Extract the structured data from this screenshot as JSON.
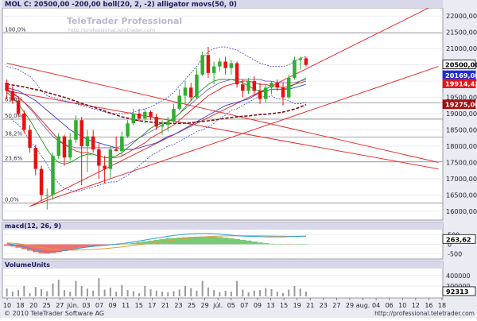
{
  "header": {
    "title": "MOL C: 20500,00 -200,00 boll(20, 2, -2) alligator movs(50, 0)",
    "watermark_brand": "TeleTrader Professional",
    "watermark_url": "http://professional.teletrader.com"
  },
  "footer": {
    "copyright": "© 2010 TeleTrader Software AG",
    "url": "http://professional.teletrader.com"
  },
  "colors": {
    "up": "#2fae2f",
    "down": "#e81010",
    "trendline": "#e63232",
    "boll_band": "#2b2bd0",
    "boll_mid": "#6a3ab0",
    "jaw": "#3b3bd8",
    "teeth": "#e21a1a",
    "lips": "#1a9a1a",
    "sma": "#7a1111",
    "macd_fill": "#ee7070",
    "macd_fill_pos": "#79c979",
    "macd_line": "#2aa0d8",
    "signal_line": "#e89a30",
    "volume": "#999999",
    "panel_bg": "#ffffff",
    "page_bg": "#ebebf3",
    "header_bg": "#d8d8ea"
  },
  "chart_data": [
    {
      "type": "candlestick",
      "title": "MOL C: 20500,00 -200,00 boll(20, 2, -2) alligator movs(50, 0)",
      "ylim": [
        15800,
        22200
      ],
      "yticks": [
        16000,
        16500,
        17000,
        17500,
        18000,
        18500,
        19000,
        19500,
        20000,
        20500,
        21000,
        21500,
        22000
      ],
      "ytick_labels": [
        "16000,00",
        "16500,00",
        "17000,00",
        "17500,00",
        "18000,00",
        "18500,00",
        "19000,00",
        "19500,00",
        "20000,00",
        "20500,00",
        "21000,00",
        "21500,00",
        "22000,00"
      ],
      "xtick_labels": [
        "10",
        "18",
        "20",
        "25",
        "27",
        "jún.",
        "03",
        "07",
        "09",
        "11",
        "15",
        "17",
        "21",
        "23",
        "25",
        "29",
        "júl.",
        "05",
        "07",
        "09",
        "13",
        "15",
        "19",
        "21",
        "23",
        "27",
        "29",
        "aug.",
        "04",
        "06",
        "10",
        "12",
        "16",
        "18"
      ],
      "candles": [
        {
          "o": 19950,
          "h": 20050,
          "l": 19450,
          "c": 19700
        },
        {
          "o": 19700,
          "h": 19850,
          "l": 19300,
          "c": 19400
        },
        {
          "o": 19400,
          "h": 19550,
          "l": 18900,
          "c": 19000
        },
        {
          "o": 19000,
          "h": 19100,
          "l": 18400,
          "c": 18500
        },
        {
          "o": 18500,
          "h": 18650,
          "l": 17800,
          "c": 17950
        },
        {
          "o": 17950,
          "h": 18050,
          "l": 17100,
          "c": 17300
        },
        {
          "o": 17300,
          "h": 17400,
          "l": 16300,
          "c": 16500
        },
        {
          "o": 16500,
          "h": 16700,
          "l": 16050,
          "c": 16500
        },
        {
          "o": 16500,
          "h": 17800,
          "l": 16350,
          "c": 17700
        },
        {
          "o": 17700,
          "h": 18400,
          "l": 17600,
          "c": 18300
        },
        {
          "o": 18300,
          "h": 18350,
          "l": 17400,
          "c": 17650
        },
        {
          "o": 17650,
          "h": 18400,
          "l": 17550,
          "c": 18200
        },
        {
          "o": 18200,
          "h": 18950,
          "l": 18100,
          "c": 18800
        },
        {
          "o": 18800,
          "h": 18900,
          "l": 16800,
          "c": 18000
        },
        {
          "o": 18000,
          "h": 18500,
          "l": 17200,
          "c": 18300
        },
        {
          "o": 18300,
          "h": 18500,
          "l": 17800,
          "c": 17900
        },
        {
          "o": 17900,
          "h": 18100,
          "l": 17000,
          "c": 17400
        },
        {
          "o": 17400,
          "h": 17700,
          "l": 16850,
          "c": 17300
        },
        {
          "o": 17300,
          "h": 18000,
          "l": 17000,
          "c": 17900
        },
        {
          "o": 17900,
          "h": 18300,
          "l": 17850,
          "c": 17850
        },
        {
          "o": 17850,
          "h": 18450,
          "l": 17700,
          "c": 18300
        },
        {
          "o": 18300,
          "h": 18800,
          "l": 18250,
          "c": 18700
        },
        {
          "o": 18700,
          "h": 19150,
          "l": 18650,
          "c": 19000
        },
        {
          "o": 19000,
          "h": 19150,
          "l": 18750,
          "c": 18850
        },
        {
          "o": 18850,
          "h": 19150,
          "l": 18700,
          "c": 19050
        },
        {
          "o": 19050,
          "h": 19100,
          "l": 18800,
          "c": 18900
        },
        {
          "o": 18900,
          "h": 19000,
          "l": 18500,
          "c": 18600
        },
        {
          "o": 18600,
          "h": 18800,
          "l": 18350,
          "c": 18650
        },
        {
          "o": 18650,
          "h": 18900,
          "l": 18450,
          "c": 18750
        },
        {
          "o": 18750,
          "h": 19300,
          "l": 18700,
          "c": 19150
        },
        {
          "o": 19150,
          "h": 19750,
          "l": 19100,
          "c": 19550
        },
        {
          "o": 19550,
          "h": 20000,
          "l": 19300,
          "c": 19800
        },
        {
          "o": 19800,
          "h": 19950,
          "l": 19400,
          "c": 19500
        },
        {
          "o": 19500,
          "h": 20400,
          "l": 19450,
          "c": 20200
        },
        {
          "o": 20200,
          "h": 20900,
          "l": 20150,
          "c": 20800
        },
        {
          "o": 20800,
          "h": 21050,
          "l": 20100,
          "c": 20250
        },
        {
          "o": 20250,
          "h": 20600,
          "l": 19900,
          "c": 20450
        },
        {
          "o": 20450,
          "h": 20700,
          "l": 20300,
          "c": 20600
        },
        {
          "o": 20600,
          "h": 20750,
          "l": 20200,
          "c": 20400
        },
        {
          "o": 20400,
          "h": 20650,
          "l": 20200,
          "c": 20550
        },
        {
          "o": 20550,
          "h": 20600,
          "l": 19800,
          "c": 19900
        },
        {
          "o": 19900,
          "h": 20050,
          "l": 19500,
          "c": 19700
        },
        {
          "o": 19700,
          "h": 20100,
          "l": 19600,
          "c": 20000
        },
        {
          "o": 20000,
          "h": 20150,
          "l": 19550,
          "c": 19700
        },
        {
          "o": 19700,
          "h": 19950,
          "l": 19300,
          "c": 19450
        },
        {
          "o": 19450,
          "h": 19900,
          "l": 19350,
          "c": 19800
        },
        {
          "o": 19800,
          "h": 20000,
          "l": 19600,
          "c": 19950
        },
        {
          "o": 19950,
          "h": 20050,
          "l": 19700,
          "c": 19800
        },
        {
          "o": 19800,
          "h": 19950,
          "l": 19250,
          "c": 19500
        },
        {
          "o": 19500,
          "h": 20200,
          "l": 19450,
          "c": 20100
        },
        {
          "o": 20100,
          "h": 20750,
          "l": 20050,
          "c": 20650
        },
        {
          "o": 20650,
          "h": 20750,
          "l": 20350,
          "c": 20700
        },
        {
          "o": 20700,
          "h": 20750,
          "l": 20450,
          "c": 20500
        }
      ],
      "bollinger": {
        "upper": [
          20450,
          20400,
          20350,
          20250,
          20150,
          19950,
          19700,
          19550,
          19500,
          19450,
          19400,
          19350,
          19300,
          19250,
          19200,
          19150,
          19100,
          19050,
          19000,
          19000,
          19000,
          19000,
          19050,
          19100,
          19150,
          19200,
          19300,
          19400,
          19500,
          19650,
          19850,
          20050,
          20250,
          20450,
          20700,
          20900,
          21000,
          21050,
          21050,
          21000,
          20950,
          20850,
          20750,
          20650,
          20550,
          20500,
          20450,
          20450,
          20450,
          20500,
          20600,
          20700,
          20750
        ],
        "middle": [
          19700,
          19600,
          19500,
          19350,
          19150,
          18950,
          18700,
          18500,
          18300,
          18150,
          18050,
          18000,
          17950,
          17950,
          17950,
          17950,
          17950,
          17950,
          17950,
          17950,
          18000,
          18050,
          18150,
          18250,
          18350,
          18450,
          18550,
          18650,
          18750,
          18850,
          19000,
          19150,
          19300,
          19450,
          19600,
          19750,
          19850,
          19950,
          20000,
          20050,
          20050,
          20050,
          20050,
          20050,
          20050,
          20000,
          20000,
          19950,
          19950,
          19950,
          19950,
          20000,
          20050
        ],
        "lower": [
          18950,
          18800,
          18650,
          18450,
          18150,
          17950,
          17700,
          17450,
          17100,
          16850,
          16700,
          16650,
          16600,
          16650,
          16700,
          16750,
          16800,
          16850,
          16900,
          16900,
          17000,
          17100,
          17250,
          17400,
          17550,
          17700,
          17800,
          17900,
          18000,
          18050,
          18150,
          18250,
          18350,
          18450,
          18500,
          18600,
          18700,
          18850,
          18950,
          19100,
          19150,
          19250,
          19350,
          19450,
          19550,
          19500,
          19550,
          19450,
          19450,
          19400,
          19300,
          19300,
          19350
        ]
      },
      "alligator": {
        "jaw": [
          19800,
          19750,
          19700,
          19600,
          19500,
          19400,
          19250,
          19100,
          18950,
          18800,
          18650,
          18500,
          18400,
          18300,
          18200,
          18150,
          18100,
          18050,
          18000,
          17950,
          17900,
          17900,
          17900,
          17950,
          18000,
          18050,
          18100,
          18200,
          18300,
          18350,
          18450,
          18550,
          18650,
          18750,
          18850,
          18950,
          19050,
          19150,
          19250,
          19300,
          19350,
          19400,
          19450,
          19550,
          19650,
          19700,
          19750,
          19750,
          19750,
          19750,
          19800,
          19850,
          19900
        ],
        "teeth": [
          19750,
          19650,
          19500,
          19350,
          19200,
          19000,
          18800,
          18600,
          18400,
          18200,
          18050,
          17950,
          17850,
          17800,
          17800,
          17750,
          17700,
          17650,
          17650,
          17650,
          17700,
          17800,
          17900,
          18000,
          18100,
          18250,
          18350,
          18450,
          18550,
          18650,
          18800,
          18950,
          19100,
          19250,
          19400,
          19550,
          19650,
          19750,
          19850,
          19900,
          19950,
          20000,
          20000,
          19950,
          19900,
          19900,
          19850,
          19850,
          19800,
          19850,
          19900,
          19950,
          20000
        ],
        "lips": [
          19650,
          19500,
          19300,
          19050,
          18800,
          18500,
          18200,
          17900,
          17650,
          17500,
          17450,
          17500,
          17600,
          17700,
          17750,
          17750,
          17700,
          17650,
          17650,
          17700,
          17800,
          17950,
          18100,
          18250,
          18400,
          18550,
          18650,
          18700,
          18750,
          18850,
          19000,
          19200,
          19400,
          19600,
          19750,
          19900,
          20000,
          20050,
          20050,
          20050,
          20000,
          19950,
          19850,
          19750,
          19700,
          19700,
          19750,
          19750,
          19750,
          19800,
          19900,
          20000,
          20100
        ]
      },
      "sma50": [
        19900,
        19880,
        19850,
        19820,
        19780,
        19740,
        19700,
        19650,
        19600,
        19550,
        19500,
        19440,
        19380,
        19320,
        19260,
        19200,
        19140,
        19080,
        19020,
        18960,
        18900,
        18860,
        18820,
        18780,
        18760,
        18740,
        18720,
        18710,
        18700,
        18700,
        18700,
        18710,
        18720,
        18740,
        18760,
        18780,
        18800,
        18830,
        18860,
        18880,
        18900,
        18920,
        18930,
        18950,
        18970,
        18980,
        19000,
        19020,
        19050,
        19090,
        19140,
        19200,
        19275
      ],
      "trendlines": [
        {
          "from": {
            "i": 4,
            "v": 16150
          },
          "to": {
            "i": 75,
            "v": 22400
          }
        },
        {
          "from": {
            "i": 4,
            "v": 16150
          },
          "to": {
            "i": 75,
            "v": 20450
          }
        },
        {
          "from": {
            "i": 0,
            "v": 19700
          },
          "to": {
            "i": 75,
            "v": 17300
          }
        },
        {
          "from": {
            "i": 0,
            "v": 20550
          },
          "to": {
            "i": 75,
            "v": 17500
          }
        }
      ],
      "fibonacci": [
        {
          "label": "100,0%",
          "value": 21480
        },
        {
          "label": "61,8%",
          "value": 19330
        },
        {
          "label": "50,0%",
          "value": 18830
        },
        {
          "label": "38,2%",
          "value": 18280
        },
        {
          "label": "23,6%",
          "value": 17520
        },
        {
          "label": "0,0%",
          "value": 16250
        }
      ],
      "price_tags": [
        {
          "label": "20500,00",
          "value": 20500,
          "style": "last"
        },
        {
          "label": "20169,00",
          "value": 20169,
          "style": "blue"
        },
        {
          "label": "19914,41",
          "value": 19914,
          "style": "red"
        },
        {
          "label": "19275,00",
          "value": 19275,
          "style": "darkred"
        }
      ]
    },
    {
      "type": "area",
      "title": "macd(12, 26, 9)",
      "ylim": [
        -700,
        700
      ],
      "yticks": [
        500,
        0,
        -500
      ],
      "ytick_labels": [
        "500",
        "0",
        "-500"
      ],
      "histogram": [
        -80,
        -120,
        -180,
        -260,
        -340,
        -420,
        -480,
        -500,
        -470,
        -420,
        -360,
        -300,
        -230,
        -180,
        -140,
        -110,
        -90,
        -70,
        -40,
        -20,
        10,
        40,
        80,
        120,
        160,
        200,
        240,
        280,
        320,
        340,
        360,
        380,
        400,
        410,
        420,
        420,
        410,
        390,
        360,
        320,
        280,
        240,
        200,
        150,
        100,
        60,
        30,
        10,
        0,
        -10,
        0,
        10,
        20
      ],
      "macd_line": [
        40,
        0,
        -60,
        -140,
        -220,
        -300,
        -360,
        -400,
        -400,
        -380,
        -340,
        -290,
        -240,
        -190,
        -150,
        -110,
        -80,
        -50,
        -20,
        10,
        40,
        80,
        130,
        180,
        230,
        280,
        330,
        380,
        430,
        470,
        510,
        540,
        560,
        575,
        580,
        580,
        570,
        550,
        520,
        490,
        460,
        440,
        430,
        420,
        410,
        400,
        400,
        400,
        400,
        410,
        420,
        430,
        440
      ],
      "signal_line": [
        80,
        60,
        30,
        -10,
        -60,
        -110,
        -160,
        -210,
        -250,
        -280,
        -300,
        -310,
        -310,
        -300,
        -290,
        -270,
        -250,
        -230,
        -200,
        -170,
        -140,
        -100,
        -60,
        -20,
        20,
        60,
        100,
        150,
        190,
        230,
        270,
        310,
        340,
        370,
        390,
        410,
        430,
        440,
        450,
        460,
        460,
        460,
        460,
        460,
        455,
        450,
        445,
        440,
        435,
        430,
        430,
        430,
        430
      ],
      "current_label": "263,62"
    },
    {
      "type": "bar",
      "title": "VolumeUnits",
      "ylim": [
        0,
        520000
      ],
      "yticks": [
        400000,
        200000
      ],
      "ytick_labels": [
        "400000",
        "200000"
      ],
      "values": [
        150000,
        90000,
        120000,
        200000,
        60000,
        180000,
        140000,
        100000,
        250000,
        320000,
        120000,
        90000,
        300000,
        200000,
        150000,
        110000,
        350000,
        130000,
        170000,
        90000,
        220000,
        120000,
        100000,
        60000,
        200000,
        140000,
        110000,
        90000,
        80000,
        100000,
        130000,
        200000,
        160000,
        110000,
        300000,
        170000,
        120000,
        80000,
        110000,
        90000,
        300000,
        130000,
        80000,
        110000,
        120000,
        160000,
        140000,
        90000,
        60000,
        130000,
        200000,
        150000,
        92313
      ],
      "current_label": "92313"
    }
  ]
}
